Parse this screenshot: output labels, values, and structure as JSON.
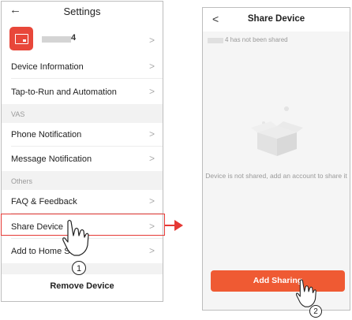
{
  "left_screen": {
    "back_glyph": "←",
    "title": "Settings",
    "device": {
      "name_suffix": "4"
    },
    "rows": [
      {
        "label": "Device Information",
        "chevron": ">"
      },
      {
        "label": "Tap-to-Run and Automation",
        "chevron": ">"
      }
    ],
    "section_vas": "VAS",
    "rows_vas": [
      {
        "label": "Phone Notification",
        "chevron": ">"
      },
      {
        "label": "Message Notification",
        "chevron": ">"
      }
    ],
    "section_others": "Others",
    "rows_others": [
      {
        "label": "FAQ & Feedback",
        "chevron": ">"
      },
      {
        "label": "Share Device",
        "chevron": ">"
      },
      {
        "label": "Add to Home S    en",
        "chevron": ">"
      }
    ],
    "remove_label": "Remove Device",
    "step_number": "1"
  },
  "right_screen": {
    "back_glyph": "<",
    "title": "Share Device",
    "subtitle": "4 has not been shared",
    "empty_message": "Device is not shared, add an account to share it",
    "add_button": "Add Sharing",
    "step_number": "2"
  },
  "colors": {
    "accent": "#ef5a33",
    "highlight": "#e53935",
    "device_icon": "#e8473a"
  },
  "icons": [
    "back-arrow-icon",
    "device-screen-icon",
    "chevron-right-icon",
    "empty-box-icon",
    "hand-pointer-icon"
  ]
}
